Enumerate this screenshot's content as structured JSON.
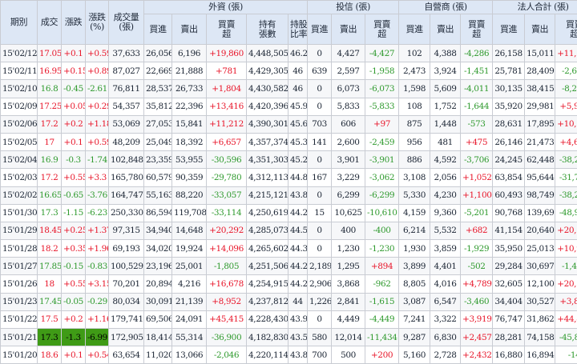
{
  "colors": {
    "up": "#e8162a",
    "down": "#2f9a2e",
    "header_bg": "#dde7f5",
    "highlight": "#3f9b16"
  },
  "header": {
    "date": "期別",
    "close": "成交",
    "change": "漲跌",
    "pct": "漲跌\n(%)",
    "volume": "成交量\n(張)",
    "foreign_group": "外資 (張)",
    "trust_group": "投信 (張)",
    "dealer_group": "自營商 (張)",
    "total_group": "法人合計 (張)",
    "buy": "買進",
    "sell": "賣出",
    "net": "買賣\n超",
    "holdings": "持有\n張數",
    "ratio": "持股\n比率"
  },
  "rows": [
    {
      "date": "15'02/12",
      "close": "17.05",
      "chg": "+0.1",
      "pct": "+0.59",
      "vol": "37,633",
      "f_buy": "26,056",
      "f_sell": "6,196",
      "f_net": "+19,860",
      "f_hold": "4,448,505",
      "f_ratio": "46.2",
      "t_buy": "0",
      "t_sell": "4,427",
      "t_net": "-4,427",
      "d_buy": "102",
      "d_sell": "4,388",
      "d_net": "-4,286",
      "s_buy": "26,158",
      "s_sell": "15,011",
      "s_net": "+11,147"
    },
    {
      "date": "15'02/11",
      "close": "16.95",
      "chg": "+0.15",
      "pct": "+0.89",
      "vol": "87,027",
      "f_buy": "22,669",
      "f_sell": "21,888",
      "f_net": "+781",
      "f_hold": "4,429,305",
      "f_ratio": "46",
      "t_buy": "639",
      "t_sell": "2,597",
      "t_net": "-1,958",
      "d_buy": "2,473",
      "d_sell": "3,924",
      "d_net": "-1,451",
      "s_buy": "25,781",
      "s_sell": "28,409",
      "s_net": "-2,628"
    },
    {
      "date": "15'02/10",
      "close": "16.8",
      "chg": "-0.45",
      "pct": "-2.61",
      "vol": "76,811",
      "f_buy": "28,537",
      "f_sell": "26,733",
      "f_net": "+1,804",
      "f_hold": "4,430,582",
      "f_ratio": "46",
      "t_buy": "0",
      "t_sell": "6,073",
      "t_net": "-6,073",
      "d_buy": "1,598",
      "d_sell": "5,609",
      "d_net": "-4,011",
      "s_buy": "30,135",
      "s_sell": "38,415",
      "s_net": "-8,280"
    },
    {
      "date": "15'02/09",
      "close": "17.25",
      "chg": "+0.05",
      "pct": "+0.29",
      "vol": "54,357",
      "f_buy": "35,812",
      "f_sell": "22,396",
      "f_net": "+13,416",
      "f_hold": "4,420,396",
      "f_ratio": "45.9",
      "t_buy": "0",
      "t_sell": "5,833",
      "t_net": "-5,833",
      "d_buy": "108",
      "d_sell": "1,752",
      "d_net": "-1,644",
      "s_buy": "35,920",
      "s_sell": "29,981",
      "s_net": "+5,939"
    },
    {
      "date": "15'02/06",
      "close": "17.2",
      "chg": "+0.2",
      "pct": "+1.18",
      "vol": "53,069",
      "f_buy": "27,053",
      "f_sell": "15,841",
      "f_net": "+11,212",
      "f_hold": "4,390,301",
      "f_ratio": "45.6",
      "t_buy": "703",
      "t_sell": "606",
      "t_net": "+97",
      "d_buy": "875",
      "d_sell": "1,448",
      "d_net": "-573",
      "s_buy": "28,631",
      "s_sell": "17,895",
      "s_net": "+10,736"
    },
    {
      "date": "15'02/05",
      "close": "17",
      "chg": "+0.1",
      "pct": "+0.59",
      "vol": "48,209",
      "f_buy": "25,049",
      "f_sell": "18,392",
      "f_net": "+6,657",
      "f_hold": "4,357,374",
      "f_ratio": "45.3",
      "t_buy": "141",
      "t_sell": "2,600",
      "t_net": "-2,459",
      "d_buy": "956",
      "d_sell": "481",
      "d_net": "+475",
      "s_buy": "26,146",
      "s_sell": "21,473",
      "s_net": "+4,673"
    },
    {
      "date": "15'02/04",
      "close": "16.9",
      "chg": "-0.3",
      "pct": "-1.74",
      "vol": "102,848",
      "f_buy": "23,359",
      "f_sell": "53,955",
      "f_net": "-30,596",
      "f_hold": "4,351,303",
      "f_ratio": "45.2",
      "t_buy": "0",
      "t_sell": "3,901",
      "t_net": "-3,901",
      "d_buy": "886",
      "d_sell": "4,592",
      "d_net": "-3,706",
      "s_buy": "24,245",
      "s_sell": "62,448",
      "s_net": "-38,203"
    },
    {
      "date": "15'02/03",
      "close": "17.2",
      "chg": "+0.55",
      "pct": "+3.3",
      "vol": "165,780",
      "f_buy": "60,579",
      "f_sell": "90,359",
      "f_net": "-29,780",
      "f_hold": "4,312,113",
      "f_ratio": "44.8",
      "t_buy": "167",
      "t_sell": "3,229",
      "t_net": "-3,062",
      "d_buy": "3,108",
      "d_sell": "2,056",
      "d_net": "+1,052",
      "s_buy": "63,854",
      "s_sell": "95,644",
      "s_net": "-31,790"
    },
    {
      "date": "15'02/02",
      "close": "16.65",
      "chg": "-0.65",
      "pct": "-3.76",
      "vol": "164,747",
      "f_buy": "55,163",
      "f_sell": "88,220",
      "f_net": "-33,057",
      "f_hold": "4,215,121",
      "f_ratio": "43.8",
      "t_buy": "0",
      "t_sell": "6,299",
      "t_net": "-6,299",
      "d_buy": "5,330",
      "d_sell": "4,230",
      "d_net": "+1,100",
      "s_buy": "60,493",
      "s_sell": "98,749",
      "s_net": "-38,256"
    },
    {
      "date": "15'01/30",
      "close": "17.3",
      "chg": "-1.15",
      "pct": "-6.23",
      "vol": "250,330",
      "f_buy": "86,594",
      "f_sell": "119,708",
      "f_net": "-33,114",
      "f_hold": "4,250,619",
      "f_ratio": "44.2",
      "t_buy": "15",
      "t_sell": "10,625",
      "t_net": "-10,610",
      "d_buy": "4,159",
      "d_sell": "9,360",
      "d_net": "-5,201",
      "s_buy": "90,768",
      "s_sell": "139,693",
      "s_net": "-48,925"
    },
    {
      "date": "15'01/29",
      "close": "18.45",
      "chg": "+0.25",
      "pct": "+1.37",
      "vol": "97,315",
      "f_buy": "34,940",
      "f_sell": "14,648",
      "f_net": "+20,292",
      "f_hold": "4,285,073",
      "f_ratio": "44.5",
      "t_buy": "0",
      "t_sell": "400",
      "t_net": "-400",
      "d_buy": "6,214",
      "d_sell": "5,532",
      "d_net": "+682",
      "s_buy": "41,154",
      "s_sell": "20,640",
      "s_net": "+20,514"
    },
    {
      "date": "15'01/28",
      "close": "18.2",
      "chg": "+0.35",
      "pct": "+1.96",
      "vol": "69,193",
      "f_buy": "34,020",
      "f_sell": "19,924",
      "f_net": "+14,096",
      "f_hold": "4,265,602",
      "f_ratio": "44.3",
      "t_buy": "0",
      "t_sell": "1,230",
      "t_net": "-1,230",
      "d_buy": "1,930",
      "d_sell": "3,859",
      "d_net": "-1,929",
      "s_buy": "35,950",
      "s_sell": "25,013",
      "s_net": "+10,937"
    },
    {
      "date": "15'01/27",
      "close": "17.85",
      "chg": "-0.15",
      "pct": "-0.83",
      "vol": "100,529",
      "f_buy": "23,196",
      "f_sell": "25,001",
      "f_net": "-1,805",
      "f_hold": "4,251,506",
      "f_ratio": "44.2",
      "t_buy": "2,189",
      "t_sell": "1,295",
      "t_net": "+894",
      "d_buy": "3,899",
      "d_sell": "4,401",
      "d_net": "-502",
      "s_buy": "29,284",
      "s_sell": "30,697",
      "s_net": "-1,413"
    },
    {
      "date": "15'01/26",
      "close": "18",
      "chg": "+0.55",
      "pct": "+3.15",
      "vol": "70,201",
      "f_buy": "20,894",
      "f_sell": "4,216",
      "f_net": "+16,678",
      "f_hold": "4,254,915",
      "f_ratio": "44.2",
      "t_buy": "2,906",
      "t_sell": "3,868",
      "t_net": "-962",
      "d_buy": "8,805",
      "d_sell": "4,016",
      "d_net": "+4,789",
      "s_buy": "32,605",
      "s_sell": "12,100",
      "s_net": "+20,505"
    },
    {
      "date": "15'01/23",
      "close": "17.45",
      "chg": "-0.05",
      "pct": "-0.29",
      "vol": "80,034",
      "f_buy": "30,091",
      "f_sell": "21,139",
      "f_net": "+8,952",
      "f_hold": "4,237,812",
      "f_ratio": "44",
      "t_buy": "1,226",
      "t_sell": "2,841",
      "t_net": "-1,615",
      "d_buy": "3,087",
      "d_sell": "6,547",
      "d_net": "-3,460",
      "s_buy": "34,404",
      "s_sell": "30,527",
      "s_net": "+3,877"
    },
    {
      "date": "15'01/22",
      "close": "17.5",
      "chg": "+0.2",
      "pct": "+1.16",
      "vol": "179,741",
      "f_buy": "69,506",
      "f_sell": "24,091",
      "f_net": "+45,415",
      "f_hold": "4,228,430",
      "f_ratio": "43.9",
      "t_buy": "0",
      "t_sell": "4,449",
      "t_net": "-4,449",
      "d_buy": "7,241",
      "d_sell": "3,322",
      "d_net": "+3,919",
      "s_buy": "76,747",
      "s_sell": "31,862",
      "s_net": "+44,885"
    },
    {
      "date": "15'01/21",
      "close": "17.3",
      "chg": "-1.3",
      "pct": "-6.99",
      "vol": "172,905",
      "f_buy": "18,414",
      "f_sell": "55,314",
      "f_net": "-36,900",
      "f_hold": "4,182,830",
      "f_ratio": "43.5",
      "t_buy": "580",
      "t_sell": "12,014",
      "t_net": "-11,434",
      "d_buy": "9,287",
      "d_sell": "6,830",
      "d_net": "+2,457",
      "s_buy": "28,281",
      "s_sell": "74,158",
      "s_net": "-45,877",
      "highlight": true
    },
    {
      "date": "15'01/20",
      "close": "18.6",
      "chg": "+0.1",
      "pct": "+0.54",
      "vol": "63,654",
      "f_buy": "11,020",
      "f_sell": "13,066",
      "f_net": "-2,046",
      "f_hold": "4,220,114",
      "f_ratio": "43.8",
      "t_buy": "700",
      "t_sell": "500",
      "t_net": "+200",
      "d_buy": "5,160",
      "d_sell": "2,728",
      "d_net": "+2,432",
      "s_buy": "16,880",
      "s_sell": "16,894",
      "s_net": "-14"
    }
  ]
}
